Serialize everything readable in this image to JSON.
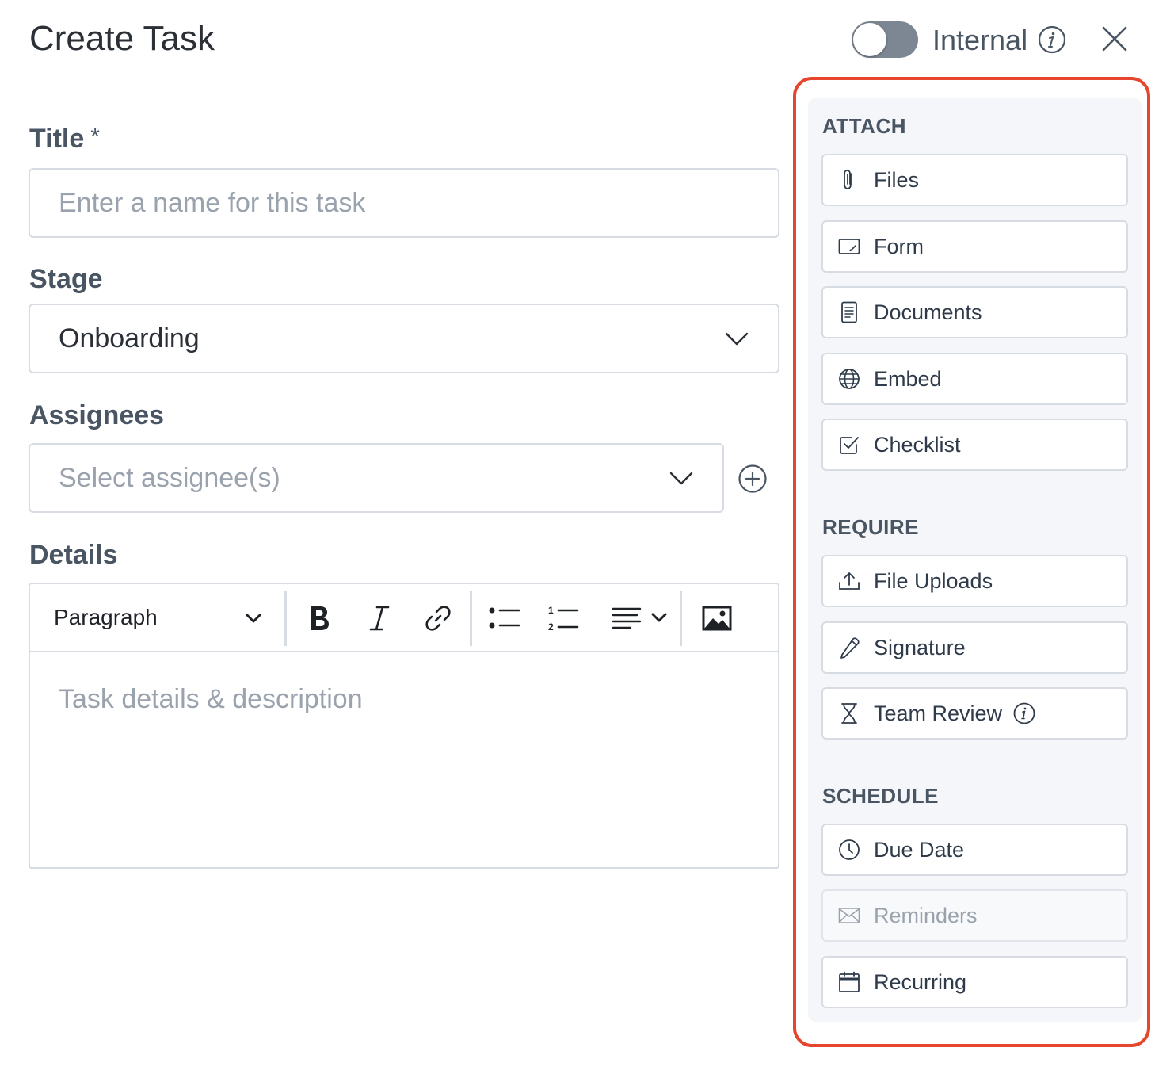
{
  "header": {
    "title": "Create Task",
    "internal_label": "Internal",
    "internal_toggle_on": false
  },
  "form": {
    "title_label": "Title",
    "title_required_mark": "*",
    "title_placeholder": "Enter a name for this task",
    "stage_label": "Stage",
    "stage_value": "Onboarding",
    "assignees_label": "Assignees",
    "assignees_placeholder": "Select assignee(s)",
    "details_label": "Details",
    "details_placeholder": "Task details & description"
  },
  "editor_toolbar": {
    "block_format": "Paragraph",
    "tools": [
      "bold-icon",
      "italic-icon",
      "link-icon",
      "bullet-list-icon",
      "numbered-list-icon",
      "align-icon",
      "image-icon"
    ]
  },
  "panel": {
    "attach_title": "ATTACH",
    "attach": [
      {
        "label": "Files",
        "icon": "paperclip-icon"
      },
      {
        "label": "Form",
        "icon": "form-icon"
      },
      {
        "label": "Documents",
        "icon": "document-icon"
      },
      {
        "label": "Embed",
        "icon": "globe-icon"
      },
      {
        "label": "Checklist",
        "icon": "checkbox-icon"
      }
    ],
    "require_title": "REQUIRE",
    "require": [
      {
        "label": "File Uploads",
        "icon": "upload-icon"
      },
      {
        "label": "Signature",
        "icon": "pen-icon"
      },
      {
        "label": "Team Review",
        "icon": "hourglass-icon"
      }
    ],
    "schedule_title": "SCHEDULE",
    "schedule": [
      {
        "label": "Due Date",
        "icon": "clock-icon"
      },
      {
        "label": "Reminders",
        "icon": "envelope-icon",
        "disabled": true
      },
      {
        "label": "Recurring",
        "icon": "calendar-icon"
      }
    ]
  },
  "colors": {
    "highlight_border": "#e6462d",
    "panel_bg": "#f4f6f9",
    "border": "#d7dce2",
    "toggle_off": "#7d8794"
  }
}
